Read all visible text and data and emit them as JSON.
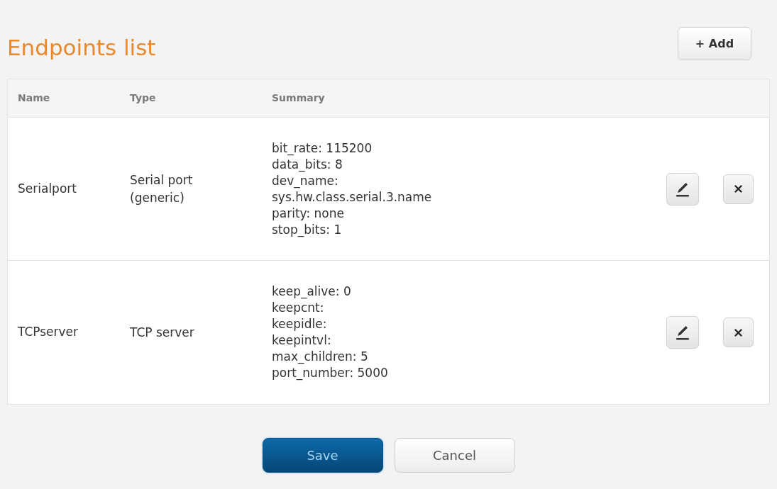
{
  "title": "Endpoints list",
  "add_button": {
    "label": "+ Add"
  },
  "table": {
    "columns": [
      "Name",
      "Type",
      "Summary"
    ],
    "rows": [
      {
        "name": "Serialport",
        "type": "Serial port (generic)",
        "summary": [
          "bit_rate: 115200",
          "data_bits: 8",
          "dev_name:",
          "sys.hw.class.serial.3.name",
          "parity: none",
          "stop_bits: 1"
        ]
      },
      {
        "name": "TCPserver",
        "type": "TCP server",
        "summary": [
          "keep_alive: 0",
          "keepcnt:",
          "keepidle:",
          "keepintvl:",
          "max_children: 5",
          "port_number: 5000"
        ]
      }
    ]
  },
  "buttons": [
    {
      "label": "Save",
      "kind": "primary"
    },
    {
      "label": "Cancel",
      "kind": "secondary"
    }
  ]
}
